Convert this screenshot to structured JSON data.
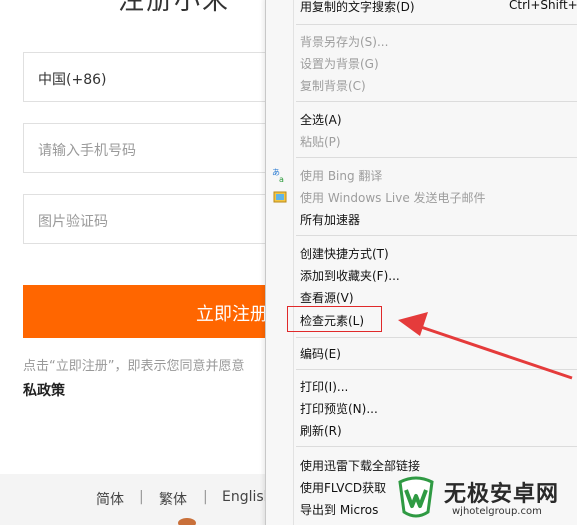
{
  "page": {
    "title_fragment": "注册小米",
    "country": "中国(+86)",
    "phone_placeholder": "请输入手机号码",
    "captcha_placeholder": "图片验证码",
    "register_label": "立即注册",
    "agreement_text": "点击“立即注册”，即表示您同意并愿意",
    "policy_text": "私政策",
    "footer": {
      "lang_simplified": "简体",
      "lang_traditional": "繁体",
      "lang_english": "English",
      "separator": "|"
    },
    "accent_color": "#ff6600"
  },
  "context_menu": {
    "items": [
      {
        "label": "用复制的文字搜索(D)",
        "shortcut": "Ctrl+Shift+L",
        "disabled": false
      },
      {
        "label": "背景另存为(S)...",
        "disabled": true
      },
      {
        "label": "设置为背景(G)",
        "disabled": true
      },
      {
        "label": "复制背景(C)",
        "disabled": true
      },
      {
        "label": "全选(A)",
        "disabled": false
      },
      {
        "label": "粘贴(P)",
        "disabled": true
      },
      {
        "label": "使用 Bing 翻译",
        "disabled": true,
        "icon": "translate-icon"
      },
      {
        "label": "使用 Windows Live 发送电子邮件",
        "disabled": true,
        "icon": "mail-icon"
      },
      {
        "label": "所有加速器",
        "disabled": false
      },
      {
        "label": "创建快捷方式(T)",
        "disabled": false
      },
      {
        "label": "添加到收藏夹(F)...",
        "disabled": false
      },
      {
        "label": "查看源(V)",
        "disabled": false
      },
      {
        "label": "检查元素(L)",
        "disabled": false,
        "highlighted": true
      },
      {
        "label": "编码(E)",
        "disabled": false
      },
      {
        "label": "打印(I)...",
        "disabled": false
      },
      {
        "label": "打印预览(N)...",
        "disabled": false
      },
      {
        "label": "刷新(R)",
        "disabled": false
      },
      {
        "label": "使用迅雷下载全部链接",
        "disabled": false
      },
      {
        "label": "使用FLVCD获取",
        "disabled": false
      },
      {
        "label": "导出到 Micros",
        "disabled": false
      }
    ],
    "highlight_color": "#e0292a"
  },
  "watermark": {
    "title": "无极安卓网",
    "url": "wjhotelgroup.com"
  }
}
